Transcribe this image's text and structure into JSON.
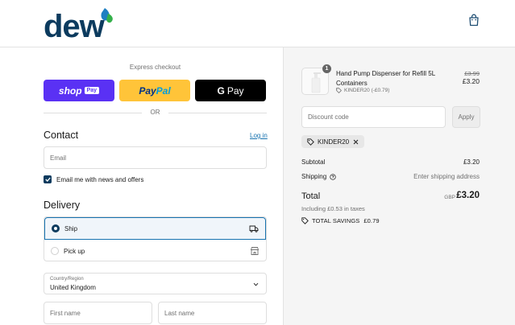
{
  "brand": {
    "logo_text": "dew",
    "colors": {
      "navy": "#0c3b5e",
      "leaf_blue": "#1e7fc2",
      "leaf_green": "#34b04a",
      "link": "#1773b0"
    }
  },
  "checkout": {
    "express_title": "Express checkout",
    "shoppay_label": "shop",
    "shoppay_badge": "Pay",
    "paypal_part1": "Pay",
    "paypal_part2": "Pal",
    "gpay_g": "G",
    "gpay_label": "Pay",
    "or_text": "OR"
  },
  "contact": {
    "title": "Contact",
    "login_link": "Log in",
    "email_placeholder": "Email",
    "news_label": "Email me with news and offers"
  },
  "delivery": {
    "title": "Delivery",
    "options": [
      {
        "label": "Ship",
        "selected": true,
        "icon": "truck-icon"
      },
      {
        "label": "Pick up",
        "selected": false,
        "icon": "store-icon"
      }
    ],
    "country_label": "Country/Region",
    "country_value": "United Kingdom",
    "first_name_placeholder": "First name",
    "last_name_placeholder": "Last name"
  },
  "summary": {
    "product": {
      "quantity": "1",
      "name": "Hand Pump Dispenser for Refill 5L Containers",
      "discount_note": "KINDER20 (-£0.79)",
      "price_old": "£3.99",
      "price_new": "£3.20"
    },
    "discount_placeholder": "Discount code",
    "apply_label": "Apply",
    "applied_code": "KINDER20",
    "subtotal_label": "Subtotal",
    "subtotal_value": "£3.20",
    "shipping_label": "Shipping",
    "shipping_value": "Enter shipping address",
    "total_label": "Total",
    "total_currency": "GBP",
    "total_value": "£3.20",
    "tax_note": "Including £0.53 in taxes",
    "savings_label": "TOTAL SAVINGS",
    "savings_value": "£0.79"
  }
}
